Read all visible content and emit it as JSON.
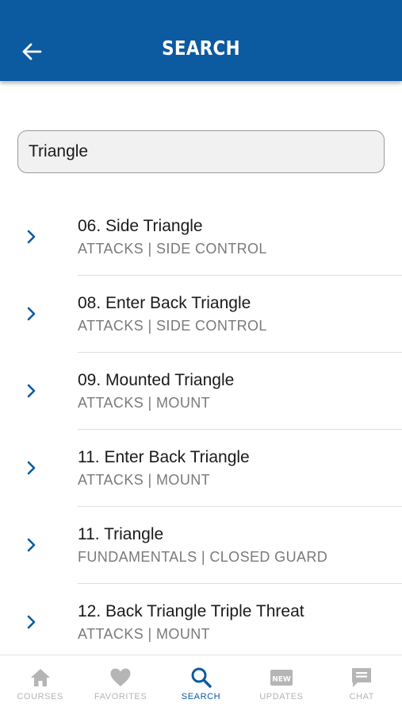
{
  "header": {
    "title": "SEARCH",
    "back_icon": "back-arrow-icon"
  },
  "search": {
    "value": "Triangle"
  },
  "results": [
    {
      "title": "06. Side Triangle",
      "subtitle": "ATTACKS | SIDE CONTROL"
    },
    {
      "title": "08. Enter Back Triangle",
      "subtitle": "ATTACKS | SIDE CONTROL"
    },
    {
      "title": "09. Mounted Triangle",
      "subtitle": "ATTACKS | MOUNT"
    },
    {
      "title": "11. Enter Back Triangle",
      "subtitle": "ATTACKS | MOUNT"
    },
    {
      "title": "11. Triangle",
      "subtitle": "FUNDAMENTALS | CLOSED GUARD"
    },
    {
      "title": "12. Back Triangle Triple Threat",
      "subtitle": "ATTACKS | MOUNT"
    }
  ],
  "tabs": [
    {
      "label": "COURSES",
      "icon": "home-icon",
      "active": false
    },
    {
      "label": "FAVORITES",
      "icon": "heart-icon",
      "active": false
    },
    {
      "label": "SEARCH",
      "icon": "search-icon",
      "active": true
    },
    {
      "label": "UPDATES",
      "icon": "new-badge-icon",
      "active": false,
      "icon_text": "NEW"
    },
    {
      "label": "CHAT",
      "icon": "chat-icon",
      "active": false
    }
  ],
  "colors": {
    "brand": "#0c5aa0",
    "inactive": "#b5b5b5",
    "subtitle": "#7a7a7a"
  }
}
